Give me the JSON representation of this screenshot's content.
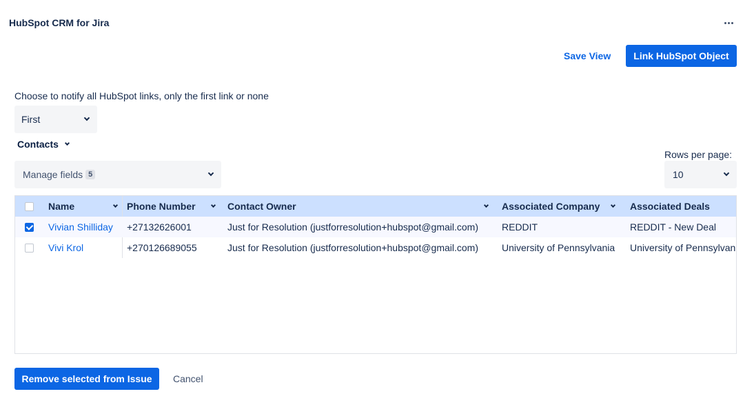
{
  "header": {
    "title": "HubSpot CRM for Jira",
    "more_icon": "more-horizontal-icon"
  },
  "actions": {
    "save_view": "Save View",
    "link_object": "Link HubSpot Object"
  },
  "notify": {
    "label": "Choose to notify all HubSpot links, only the first link or none",
    "selected": "First"
  },
  "section": {
    "label": "Contacts"
  },
  "manage_fields": {
    "label": "Manage fields",
    "count": "5"
  },
  "rows_per_page": {
    "label": "Rows per page:",
    "selected": "10"
  },
  "table": {
    "columns": [
      "Name",
      "Phone Number",
      "Contact Owner",
      "Associated Company",
      "Associated Deals"
    ],
    "rows": [
      {
        "checked": true,
        "name": "Vivian Shilliday",
        "phone": "+27132626001",
        "owner": "Just for Resolution (justforresolution+hubspot@gmail.com)",
        "company": "REDDIT",
        "deals": "REDDIT - New Deal"
      },
      {
        "checked": false,
        "name": "Vivi Krol",
        "phone": "+270126689055",
        "owner": "Just for Resolution (justforresolution+hubspot@gmail.com)",
        "company": "University of Pennsylvania",
        "deals": "University of Pennsylvania"
      }
    ]
  },
  "footer": {
    "remove": "Remove selected from Issue",
    "cancel": "Cancel"
  },
  "colors": {
    "accent": "#0c66e4",
    "header_bg": "#cce0ff",
    "text": "#172b4d"
  }
}
